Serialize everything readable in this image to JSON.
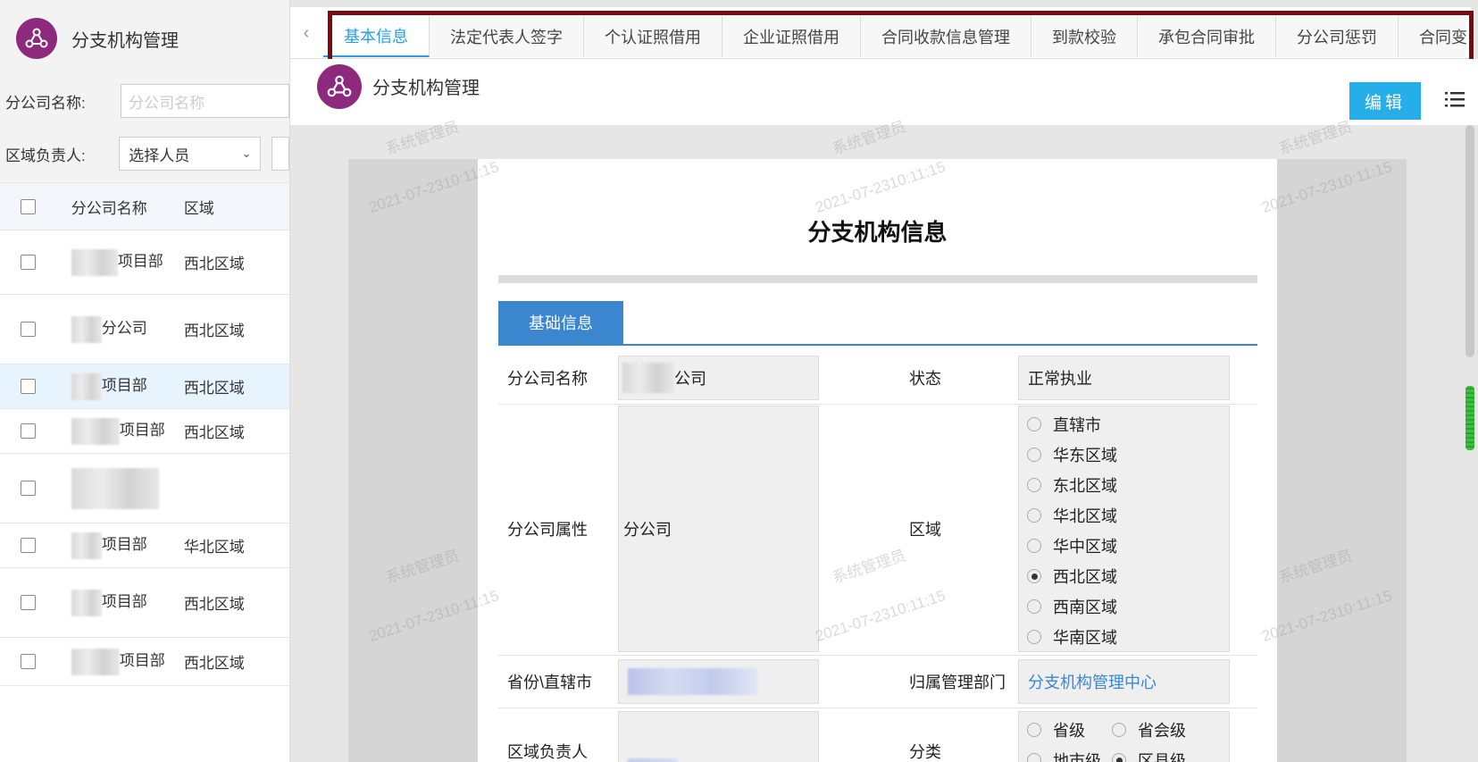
{
  "left": {
    "app_title": "分支机构管理",
    "filters": {
      "name_label": "分公司名称:",
      "name_placeholder": "分公司名称",
      "leader_label": "区域负责人:",
      "leader_value": "选择人员"
    },
    "columns": {
      "name": "分公司名称",
      "area": "区域"
    },
    "rows": [
      {
        "name": "项目部",
        "area": "西北区域"
      },
      {
        "name": "分公司",
        "area": "西北区域"
      },
      {
        "name": "项目部",
        "area": "西北区域"
      },
      {
        "name": "项目部",
        "area": "西北区域"
      },
      {
        "name": "",
        "area": ""
      },
      {
        "name": "项目部",
        "area": "华北区域"
      },
      {
        "name": "项目部",
        "area": "西北区域"
      },
      {
        "name": "项目部",
        "area": "西北区域"
      }
    ]
  },
  "tabs": [
    "基本信息",
    "法定代表人签字",
    "个认证照借用",
    "企业证照借用",
    "合同收款信息管理",
    "到款校验",
    "承包合同审批",
    "分公司惩罚",
    "合同变更"
  ],
  "page": {
    "title": "分支机构管理",
    "edit_label": "编辑"
  },
  "doc": {
    "title": "分支机构信息",
    "section": "基础信息",
    "fields": {
      "company_name_label": "分公司名称",
      "company_name_value": "公司",
      "status_label": "状态",
      "status_value": "正常执业",
      "attr_label": "分公司属性",
      "attr_value": "分公司",
      "area_label": "区域",
      "province_label": "省份\\直辖市",
      "dept_label": "归属管理部门",
      "dept_value": "分支机构管理中心",
      "leader_label": "区域负责人",
      "category_label": "分类"
    },
    "areas": [
      "直辖市",
      "华东区域",
      "东北区域",
      "华北区域",
      "华中区域",
      "西北区域",
      "西南区域",
      "华南区域"
    ],
    "selected_area": "西北区域",
    "categories": [
      "省级",
      "省会级",
      "地市级",
      "区县级"
    ],
    "selected_category": "区县级"
  },
  "watermark": {
    "user": "系统管理员",
    "time": "2021-07-2310:11:15"
  },
  "colors": {
    "accent": "#2b9de8",
    "brand": "#8e2a7e",
    "highlight": "#7a0a0e",
    "section": "#3a86cf"
  }
}
